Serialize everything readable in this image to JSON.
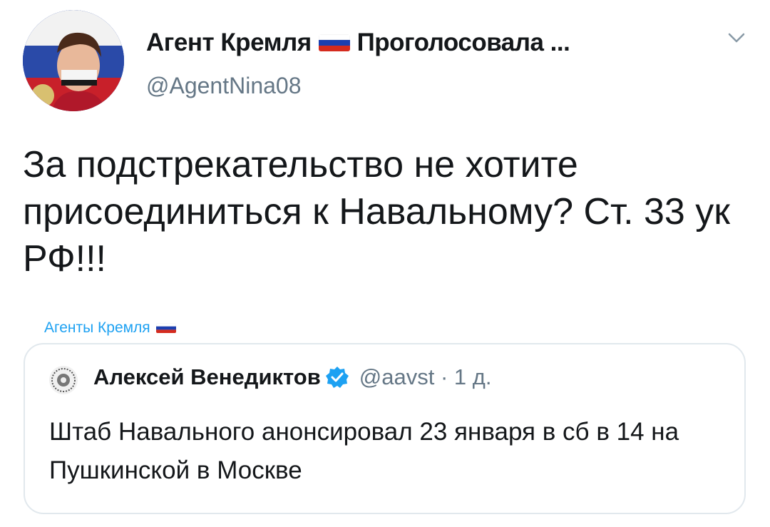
{
  "author": {
    "display_name_part1": "Агент Кремля",
    "display_name_part2": "Проголосовала ...",
    "handle": "@AgentNina08",
    "flag_icon": "russia-flag-icon"
  },
  "tweet": {
    "text": "За подстрекательство не хотите присоединиться к Навальному? Ст. 33 ук РФ!!!"
  },
  "source": {
    "label": "Агенты Кремля"
  },
  "quoted_tweet": {
    "author_name": "Алексей Венедиктов",
    "handle_time": "@aavst · 1 д.",
    "text": "Штаб Навального анонсировал 23 января в сб в 14 на Пушкинской в Москве",
    "verified_icon": "verified-badge-icon"
  },
  "colors": {
    "text": "#14171a",
    "secondary": "#657786",
    "accent": "#1da1f2",
    "border": "#e1e8ed"
  }
}
